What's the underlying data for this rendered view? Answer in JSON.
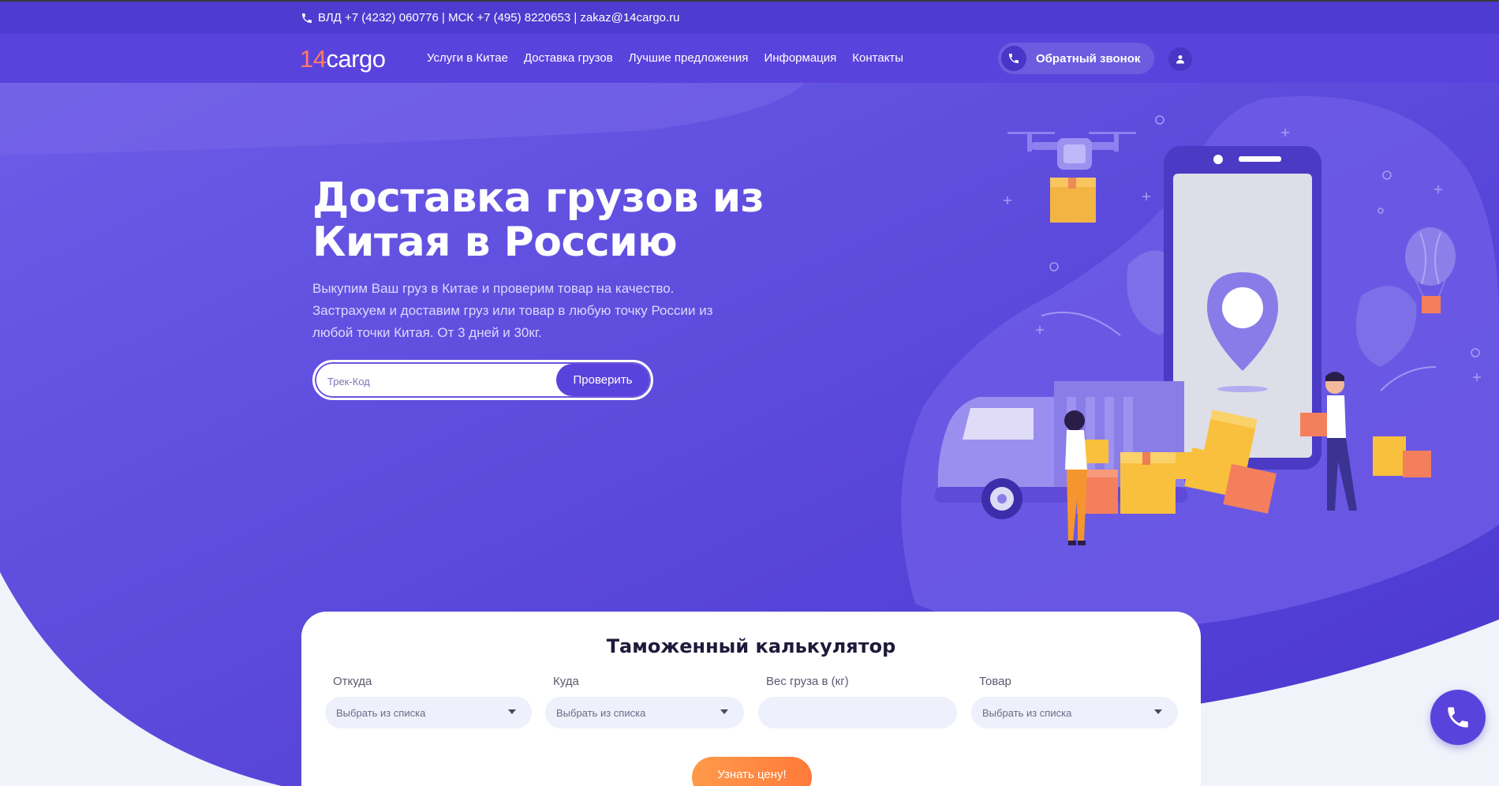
{
  "topbar": {
    "contacts": "ВЛД +7 (4232) 060776 | МСК +7 (495) 8220653 | zakaz@14cargo.ru",
    "icon": "phone-icon"
  },
  "navbar": {
    "logo_num": "14",
    "logo_text": "cargo",
    "links": [
      "Услуги в Китае",
      "Доставка грузов",
      "Лучшие предложения",
      "Информация",
      "Контакты"
    ],
    "callback_label": "Обратный звонок",
    "user_icon": "user-icon"
  },
  "hero": {
    "title_line1": "Доставка грузов из",
    "title_line2": "Китая в Россию",
    "subtitle_line1": "Выкупим Ваш груз в Китае и проверим товар на качество.",
    "subtitle_line2": "Застрахуем и доставим груз или товар в любую точку России из",
    "subtitle_line3": "любой точки Китая. От 3 дней и 30кг.",
    "track_placeholder": "Трек-Код",
    "track_button": "Проверить"
  },
  "calculator": {
    "title": "Таможенный калькулятор",
    "fields": [
      {
        "label": "Откуда",
        "value": "Выбрать из списка"
      },
      {
        "label": "Куда",
        "value": "Выбрать из списка"
      },
      {
        "label": "Вес груза в (кг)",
        "value": ""
      },
      {
        "label": "Товар",
        "value": "Выбрать из списка"
      }
    ],
    "submit_label": "Узнать цену!"
  },
  "colors": {
    "topbar": "#4e3bcf",
    "navbar": "#5a43dc",
    "hero": "#5a43dc",
    "accent_orange": "#ff8a3d",
    "box_yellow": "#f8c03d",
    "box_orange": "#f47f5c"
  }
}
